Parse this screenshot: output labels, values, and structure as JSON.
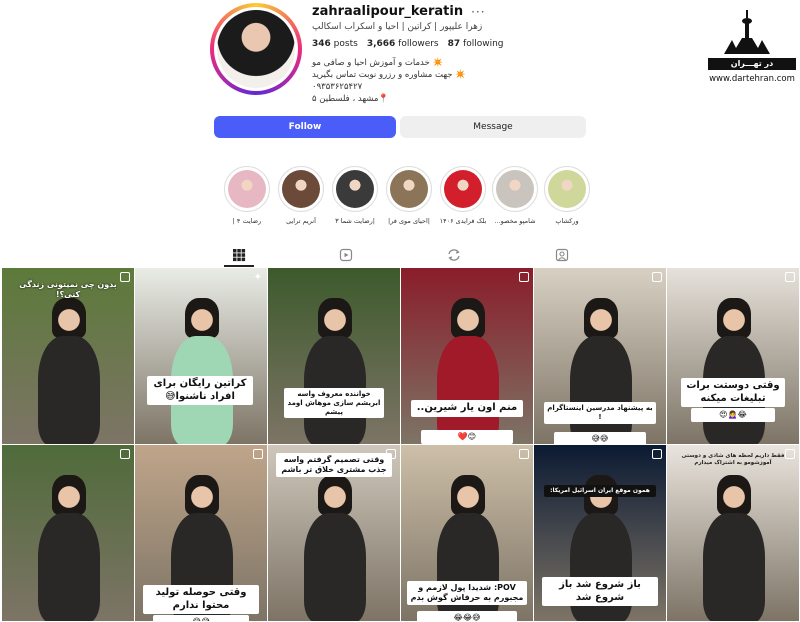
{
  "profile": {
    "username": "zahraalipour_keratin",
    "more": "···",
    "fullname": "زهرا علیپور | کراتین | احیا و اسکراب اسکالپ",
    "posts_count": "346",
    "posts_label": "posts",
    "followers_count": "3,666",
    "followers_label": "followers",
    "following_count": "87",
    "following_label": "following",
    "bio_lines": [
      "✴️ خدمات و آموزش احیا و صافی مو",
      "✴️ جهت مشاوره و رزرو نوبت تماس بگیرید",
      "۰۹۳۵۳۶۲۵۴۲۷",
      "📍مشهد ، فلسطین ۵"
    ]
  },
  "logo": {
    "banner": "در تهـــران",
    "url": "www.dartehran.com"
  },
  "actions": {
    "follow": "Follow",
    "message": "Message"
  },
  "highlights": [
    {
      "label": "رضایت ۴ |",
      "color": "#e7b7c3"
    },
    {
      "label": "آنریم ترایی",
      "color": "#6b4a3a"
    },
    {
      "label": "|رضایت شما ۳",
      "color": "#3a3a3a"
    },
    {
      "label": "|احیای موی فر|",
      "color": "#8c7458"
    },
    {
      "label": "بلک فرایدی ۱۴۰۶",
      "color": "#d21f2b"
    },
    {
      "label": "شامپو مخصو...",
      "color": "#c9c5be"
    },
    {
      "label": "ورکشاپ",
      "color": "#cfd79a"
    }
  ],
  "posts": [
    {
      "caption": "بدون چی نمیتونی زندگی کنی؟!",
      "sub": "",
      "bg": "#5c7a3a"
    },
    {
      "caption": "کراتین رایگان برای افراد ناشنوا😅",
      "sub": "",
      "bg": "#e9ece6"
    },
    {
      "caption": "خواننده معروف واسه ابریشم سازی موهاش اومد پیشم",
      "sub": "",
      "bg": "#3d5a2c"
    },
    {
      "caption": "منم اون یار شیرین..",
      "sub": "😊❤️",
      "bg": "#8a1d2a"
    },
    {
      "caption": "به پیشنهاد مدرسین اینستاگرام !",
      "sub": "😅😅",
      "bg": "#d8d0c2"
    },
    {
      "caption": "وقتی دوستت برات تبلیغات میکنه",
      "sub": "😂🙍‍♀️😍",
      "bg": "#e6e1da"
    },
    {
      "caption": "",
      "sub": "",
      "bg": "#4f6b3a"
    },
    {
      "caption": "وقتی حوصله تولید محتوا ندارم",
      "sub": "😅😂",
      "bg": "#bfa58a"
    },
    {
      "caption": "وقتی تصمیم گرفتم واسه جذب مشتری خلاق تر باشم",
      "sub": "",
      "bg": "#cfc7bb"
    },
    {
      "caption": "POV: شدیدا پول لازمم و مجبورم به حرفاش گوش بدم",
      "sub": "😅😂😂",
      "bg": "#cdbfa8"
    },
    {
      "caption": "باز شروع شد باز شروع شد",
      "sub": "همون موقع ایران اسرائیل امریکا:",
      "bg": "#0b1a33"
    },
    {
      "caption": "",
      "sub": "فقط داریم لحظه های شادی و دوستی آموزشومو به اشتراک میذارم",
      "bg": "#e9e4dd"
    }
  ]
}
